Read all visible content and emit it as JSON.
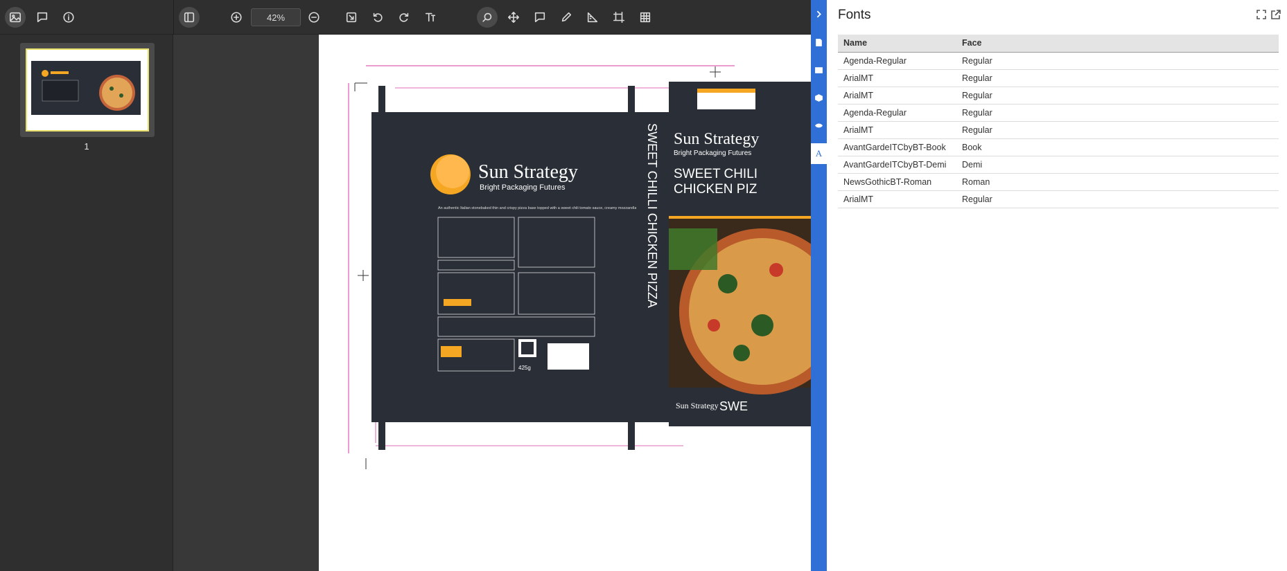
{
  "toolbar": {
    "zoom_value": "42%"
  },
  "sidebar": {
    "page_number": "1"
  },
  "artwork": {
    "brand_name": "Sun Strategy",
    "brand_tagline": "Bright Packaging Futures",
    "product_side": "SWEET CHILLI CHICKEN PIZZA",
    "product_front_line1": "SWEET CHILI",
    "product_front_line2": "CHICKEN PIZ",
    "front_brand_short": "Sun Strategy",
    "front_bottom_label": "SWE",
    "description": "An authentic Italian stonebaked thin and crispy pizza base topped with a sweet chili tomato sauce, creamy mozzarella, cooked seasoned sweet chicken breast and spinach",
    "weight": "425g"
  },
  "tabs": [
    {
      "icon": "chevron-right-icon"
    },
    {
      "icon": "document-icon"
    },
    {
      "icon": "image-icon"
    },
    {
      "icon": "cube-icon"
    },
    {
      "icon": "eye-icon"
    },
    {
      "icon": "font-icon",
      "label": "A"
    }
  ],
  "fonts_panel": {
    "title": "Fonts",
    "columns": [
      "Name",
      "Face"
    ],
    "rows": [
      {
        "name": "Agenda-Regular",
        "face": "Regular"
      },
      {
        "name": "ArialMT",
        "face": "Regular"
      },
      {
        "name": "ArialMT",
        "face": "Regular"
      },
      {
        "name": "Agenda-Regular",
        "face": "Regular"
      },
      {
        "name": "ArialMT",
        "face": "Regular"
      },
      {
        "name": "AvantGardeITCbyBT-Book",
        "face": "Book"
      },
      {
        "name": "AvantGardeITCbyBT-Demi",
        "face": "Demi"
      },
      {
        "name": "NewsGothicBT-Roman",
        "face": "Roman"
      },
      {
        "name": "ArialMT",
        "face": "Regular"
      }
    ]
  },
  "colors": {
    "accent_blue": "#2f6fd6",
    "box_dark": "#2a2f37",
    "brand_orange": "#f5a623",
    "dieline_magenta": "#d63a9c"
  }
}
